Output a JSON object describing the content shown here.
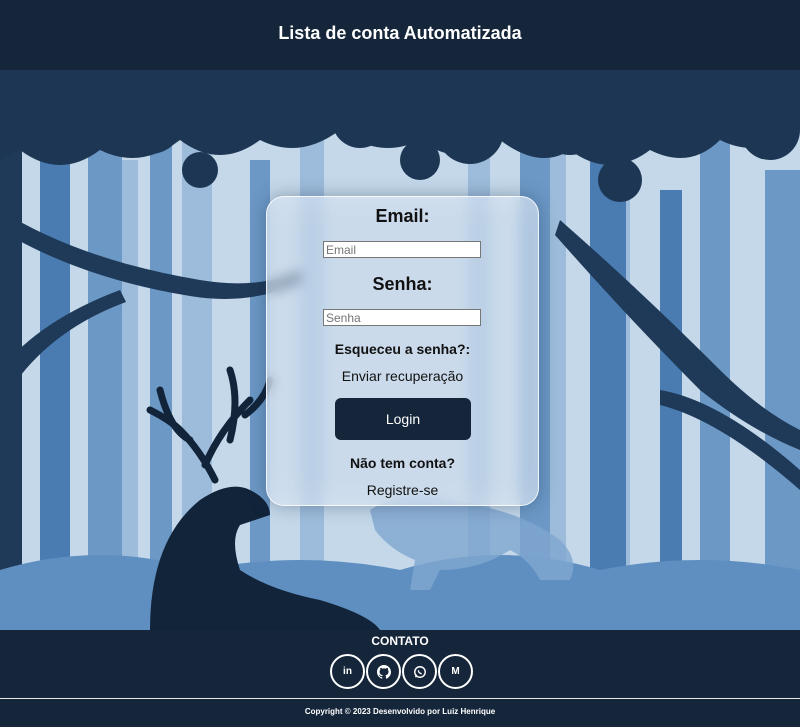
{
  "header": {
    "title": "Lista de conta Automatizada"
  },
  "login": {
    "email_label": "Email:",
    "email_placeholder": "Email",
    "password_label": "Senha:",
    "password_placeholder": "Senha",
    "forgot_text": "Esqueceu a senha?:",
    "recover_link": "Enviar recuperação",
    "login_button": "Login",
    "no_account_text": "Não tem conta?",
    "register_link": "Registre-se"
  },
  "footer": {
    "contact_title": "CONTATO",
    "social": [
      {
        "icon": "linkedin-icon",
        "glyph": "in"
      },
      {
        "icon": "github-icon",
        "glyph": ""
      },
      {
        "icon": "whatsapp-icon",
        "glyph": ""
      },
      {
        "icon": "gmail-icon",
        "glyph": "M"
      }
    ],
    "copyright": "Copyright © 2023 Desenvolvido por Luiz Henrique"
  },
  "colors": {
    "navy": "#15263a",
    "sky": "#c4d8ea",
    "button": "#15263a"
  }
}
